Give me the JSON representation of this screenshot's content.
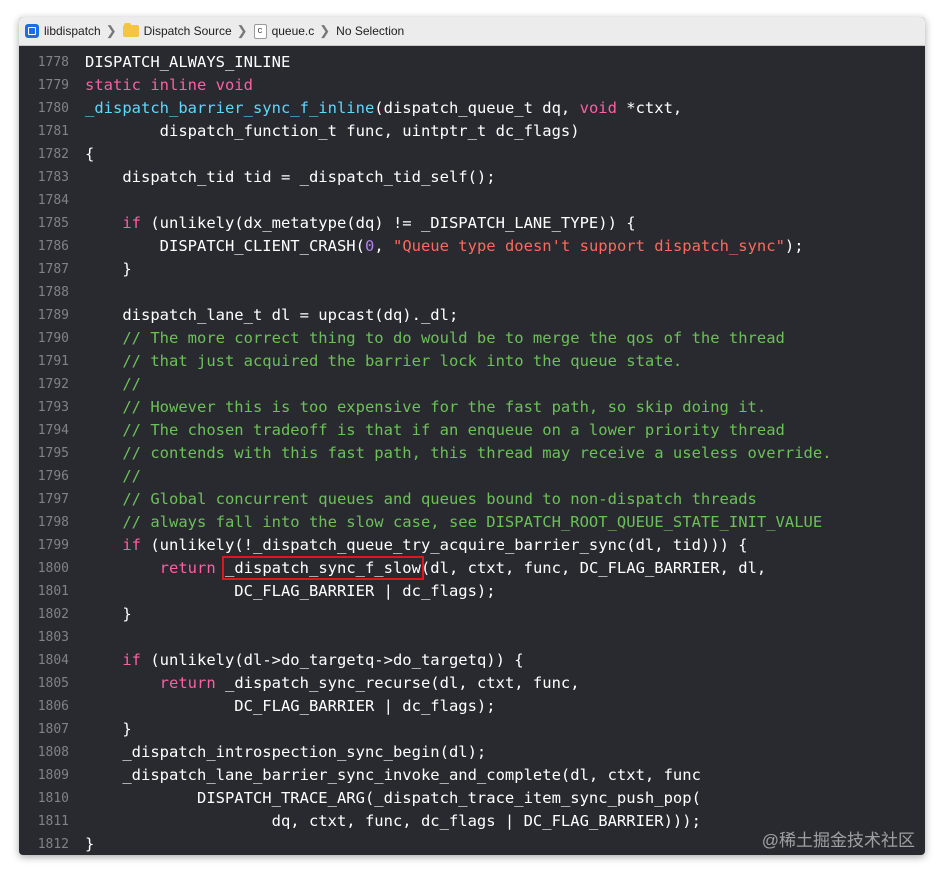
{
  "breadcrumb": {
    "project": "libdispatch",
    "group": "Dispatch Source",
    "file": "queue.c",
    "selection": "No Selection",
    "file_icon_letter": "c"
  },
  "editor": {
    "lines": [
      {
        "n": "1778",
        "tokens": [
          {
            "t": "DISPATCH_ALWAYS_INLINE",
            "c": ""
          }
        ]
      },
      {
        "n": "1779",
        "tokens": [
          {
            "t": "static inline void",
            "c": "kw"
          }
        ]
      },
      {
        "n": "1780",
        "tokens": [
          {
            "t": "_dispatch_barrier_sync_f_inline",
            "c": "fn"
          },
          {
            "t": "(dispatch_queue_t dq, ",
            "c": ""
          },
          {
            "t": "void",
            "c": "kw"
          },
          {
            "t": " *ctxt,",
            "c": ""
          }
        ]
      },
      {
        "n": "1781",
        "tokens": [
          {
            "t": "        dispatch_function_t func, uintptr_t dc_flags)",
            "c": ""
          }
        ]
      },
      {
        "n": "1782",
        "tokens": [
          {
            "t": "{",
            "c": ""
          }
        ]
      },
      {
        "n": "1783",
        "tokens": [
          {
            "t": "    dispatch_tid tid = _dispatch_tid_self();",
            "c": ""
          }
        ]
      },
      {
        "n": "1784",
        "tokens": []
      },
      {
        "n": "1785",
        "tokens": [
          {
            "t": "    ",
            "c": ""
          },
          {
            "t": "if",
            "c": "kw"
          },
          {
            "t": " (unlikely(dx_metatype(dq) != _DISPATCH_LANE_TYPE)) {",
            "c": ""
          }
        ]
      },
      {
        "n": "1786",
        "tokens": [
          {
            "t": "        DISPATCH_CLIENT_CRASH(",
            "c": ""
          },
          {
            "t": "0",
            "c": "kwd"
          },
          {
            "t": ", ",
            "c": ""
          },
          {
            "t": "\"Queue type doesn't support dispatch_sync\"",
            "c": "str"
          },
          {
            "t": ");",
            "c": ""
          }
        ]
      },
      {
        "n": "1787",
        "tokens": [
          {
            "t": "    }",
            "c": ""
          }
        ]
      },
      {
        "n": "1788",
        "tokens": []
      },
      {
        "n": "1789",
        "tokens": [
          {
            "t": "    dispatch_lane_t dl = upcast(dq)._dl;",
            "c": ""
          }
        ]
      },
      {
        "n": "1790",
        "tokens": [
          {
            "t": "    // The more correct thing to do would be to merge the qos of the thread",
            "c": "cm"
          }
        ]
      },
      {
        "n": "1791",
        "tokens": [
          {
            "t": "    // that just acquired the barrier lock into the queue state.",
            "c": "cm"
          }
        ]
      },
      {
        "n": "1792",
        "tokens": [
          {
            "t": "    //",
            "c": "cm"
          }
        ]
      },
      {
        "n": "1793",
        "tokens": [
          {
            "t": "    // However this is too expensive for the fast path, so skip doing it.",
            "c": "cm"
          }
        ]
      },
      {
        "n": "1794",
        "tokens": [
          {
            "t": "    // The chosen tradeoff is that if an enqueue on a lower priority thread",
            "c": "cm"
          }
        ]
      },
      {
        "n": "1795",
        "tokens": [
          {
            "t": "    // contends with this fast path, this thread may receive a useless override.",
            "c": "cm"
          }
        ]
      },
      {
        "n": "1796",
        "tokens": [
          {
            "t": "    //",
            "c": "cm"
          }
        ]
      },
      {
        "n": "1797",
        "tokens": [
          {
            "t": "    // Global concurrent queues and queues bound to non-dispatch threads",
            "c": "cm"
          }
        ]
      },
      {
        "n": "1798",
        "tokens": [
          {
            "t": "    // always fall into the slow case, see DISPATCH_ROOT_QUEUE_STATE_INIT_VALUE",
            "c": "cm"
          }
        ]
      },
      {
        "n": "1799",
        "tokens": [
          {
            "t": "    ",
            "c": ""
          },
          {
            "t": "if",
            "c": "kw"
          },
          {
            "t": " (unlikely(!_dispatch_queue_try_acquire_barrier_sync(dl, tid))) {",
            "c": ""
          }
        ]
      },
      {
        "n": "1800",
        "tokens": [
          {
            "t": "        ",
            "c": ""
          },
          {
            "t": "return",
            "c": "kw"
          },
          {
            "t": " ",
            "c": ""
          },
          {
            "t": "_dispatch_sync_f_slow",
            "c": "hl"
          },
          {
            "t": "(dl, ctxt, func, DC_FLAG_BARRIER, dl,",
            "c": ""
          }
        ]
      },
      {
        "n": "1801",
        "tokens": [
          {
            "t": "                DC_FLAG_BARRIER | dc_flags);",
            "c": ""
          }
        ]
      },
      {
        "n": "1802",
        "tokens": [
          {
            "t": "    }",
            "c": ""
          }
        ]
      },
      {
        "n": "1803",
        "tokens": []
      },
      {
        "n": "1804",
        "tokens": [
          {
            "t": "    ",
            "c": ""
          },
          {
            "t": "if",
            "c": "kw"
          },
          {
            "t": " (unlikely(dl->do_targetq->do_targetq)) {",
            "c": ""
          }
        ]
      },
      {
        "n": "1805",
        "tokens": [
          {
            "t": "        ",
            "c": ""
          },
          {
            "t": "return",
            "c": "kw"
          },
          {
            "t": " _dispatch_sync_recurse(dl, ctxt, func,",
            "c": ""
          }
        ]
      },
      {
        "n": "1806",
        "tokens": [
          {
            "t": "                DC_FLAG_BARRIER | dc_flags);",
            "c": ""
          }
        ]
      },
      {
        "n": "1807",
        "tokens": [
          {
            "t": "    }",
            "c": ""
          }
        ]
      },
      {
        "n": "1808",
        "tokens": [
          {
            "t": "    _dispatch_introspection_sync_begin(dl);",
            "c": ""
          }
        ]
      },
      {
        "n": "1809",
        "tokens": [
          {
            "t": "    _dispatch_lane_barrier_sync_invoke_and_complete(dl, ctxt, func",
            "c": ""
          }
        ]
      },
      {
        "n": "1810",
        "tokens": [
          {
            "t": "            DISPATCH_TRACE_ARG(_dispatch_trace_item_sync_push_pop(",
            "c": ""
          }
        ]
      },
      {
        "n": "1811",
        "tokens": [
          {
            "t": "                    dq, ctxt, func, dc_flags | DC_FLAG_BARRIER)));",
            "c": ""
          }
        ]
      },
      {
        "n": "1812",
        "tokens": [
          {
            "t": "}",
            "c": ""
          }
        ]
      }
    ]
  },
  "watermark": "@稀土掘金技术社区",
  "colors": {
    "background": "#292a30",
    "keyword": "#fc5fa3",
    "function": "#5dd8ff",
    "string": "#fc6a5d",
    "comment": "#6bc157",
    "number": "#b281eb",
    "highlight_box": "#e0161d"
  }
}
